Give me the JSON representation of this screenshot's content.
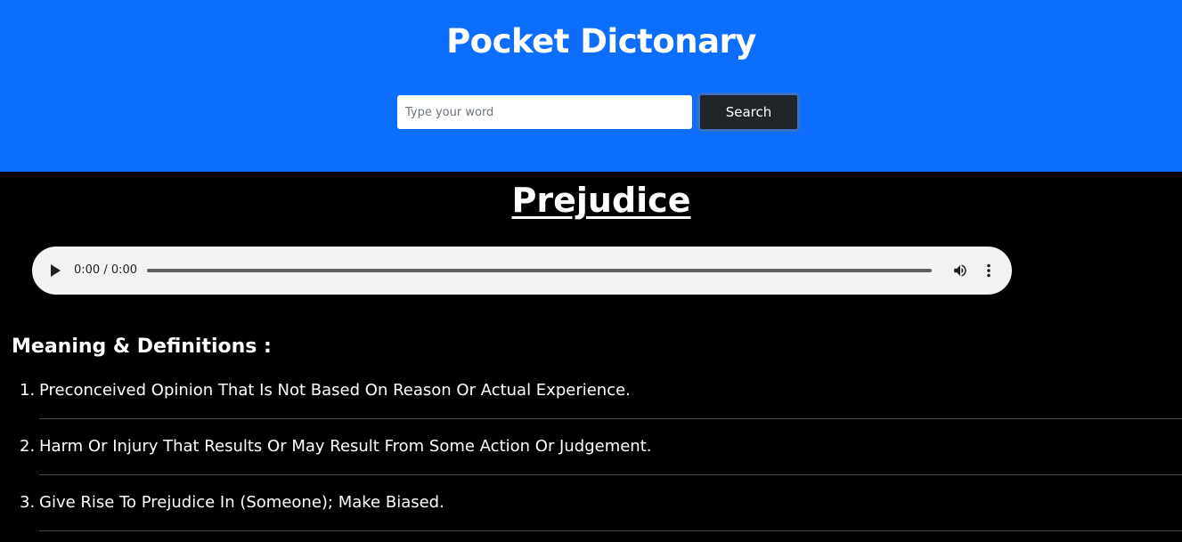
{
  "header": {
    "title": "Pocket Dictonary",
    "background_color": "#0d6efd"
  },
  "search": {
    "placeholder": "Type your word",
    "value": "",
    "button_label": "Search"
  },
  "word": {
    "title": "Prejudice"
  },
  "audio": {
    "time": "0:00 / 0:00",
    "play_icon": "play-icon",
    "volume_icon": "volume-icon",
    "more_icon": "more-vertical-icon"
  },
  "definitions": {
    "heading": "Meaning & Definitions :",
    "items": [
      {
        "number": "1.",
        "text": "Preconceived Opinion That Is Not Based On Reason Or Actual Experience."
      },
      {
        "number": "2.",
        "text": "Harm Or Injury That Results Or May Result From Some Action Or Judgement."
      },
      {
        "number": "3.",
        "text": "Give Rise To Prejudice In (Someone); Make Biased."
      }
    ]
  }
}
